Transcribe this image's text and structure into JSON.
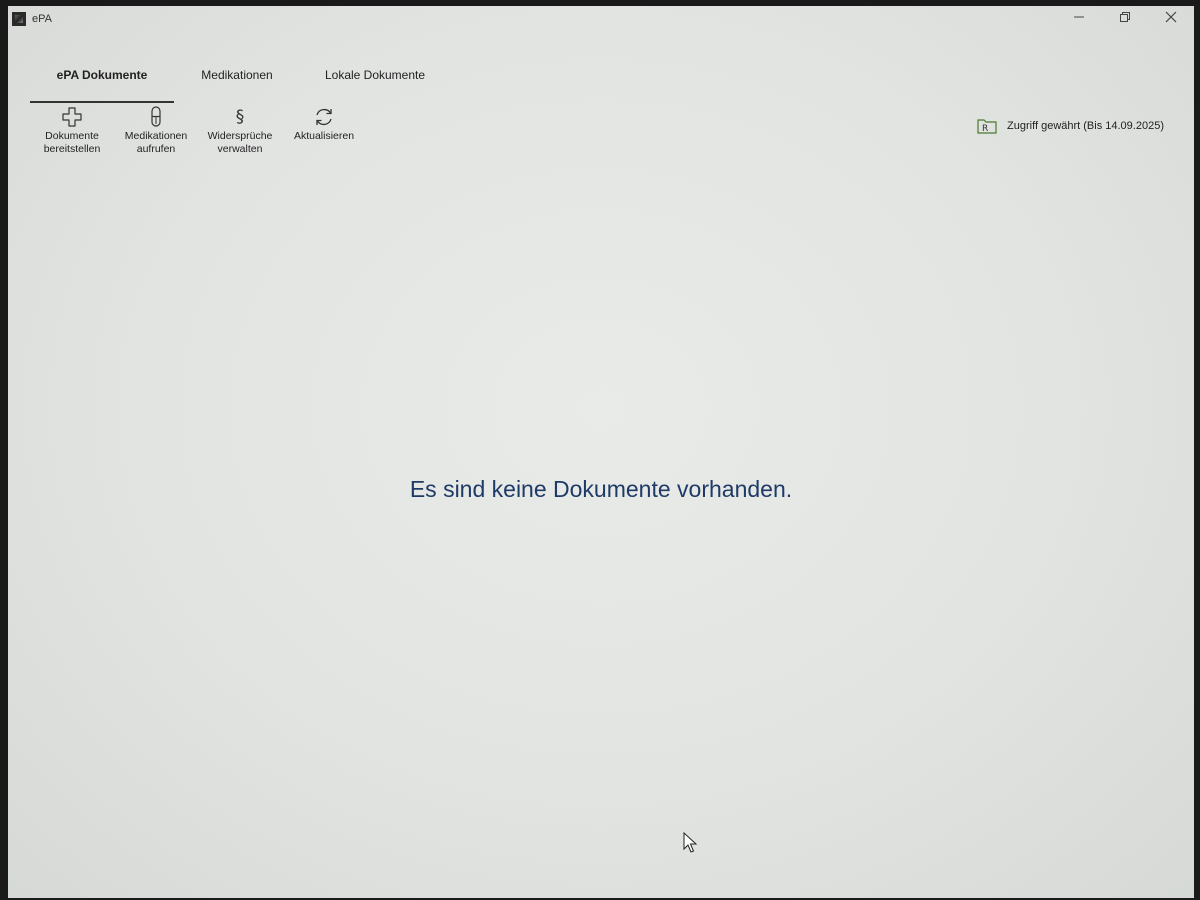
{
  "window": {
    "title": "ePA",
    "logo_icon": "app-logo-icon",
    "controls": {
      "minimize": "minimize-icon",
      "restore": "restore-icon",
      "close": "close-icon"
    }
  },
  "tabs": [
    {
      "label": "ePA Dokumente",
      "active": true
    },
    {
      "label": "Medikationen",
      "active": false
    },
    {
      "label": "Lokale Dokumente",
      "active": false
    }
  ],
  "toolbar": {
    "items": [
      {
        "label": "Dokumente\nbereitstellen",
        "icon": "plus-icon"
      },
      {
        "label": "Medikationen\naufrufen",
        "icon": "pill-icon"
      },
      {
        "label": "Widersprüche\nverwalten",
        "icon": "paragraph-icon"
      },
      {
        "label": "Aktualisieren",
        "icon": "refresh-icon"
      }
    ]
  },
  "access_status": {
    "text": "Zugriff gewährt (Bis 14.09.2025)",
    "icon": "folder-access-icon",
    "icon_color": "#4a7a2a"
  },
  "main": {
    "empty_message": "Es sind keine Dokumente vorhanden.",
    "message_color": "#1e3a66"
  }
}
